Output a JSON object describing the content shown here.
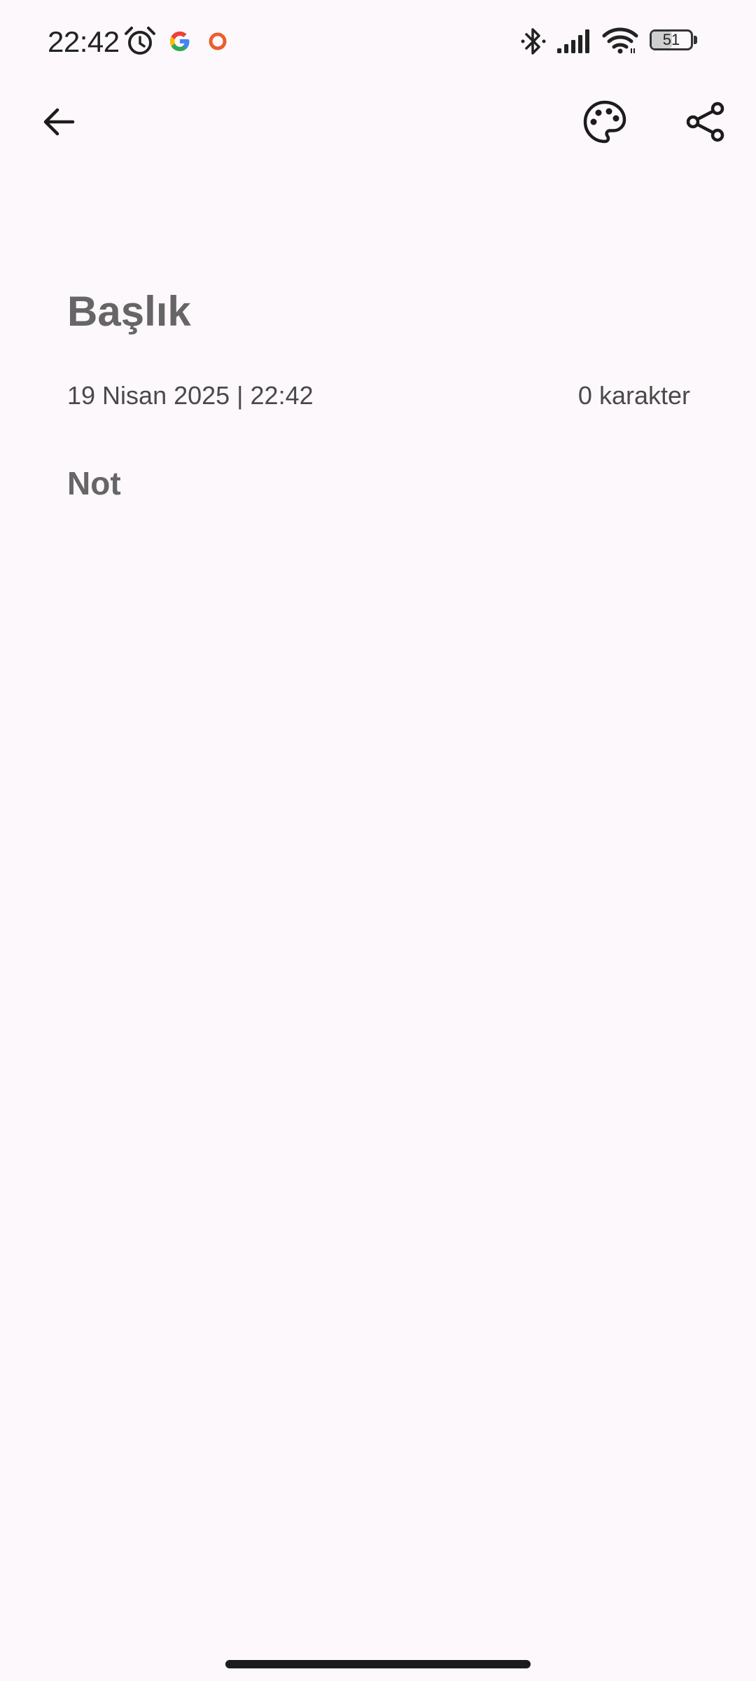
{
  "status_bar": {
    "time": "22:42",
    "battery_level": "51",
    "battery_fraction": 0.51,
    "icons": [
      "alarm-icon",
      "google-icon",
      "notification-dot-icon",
      "bluetooth-icon",
      "cellular-signal-icon",
      "wifi-icon",
      "battery-icon"
    ]
  },
  "app_bar": {
    "icons": [
      "back-arrow-icon",
      "palette-icon",
      "share-icon"
    ]
  },
  "note": {
    "title_placeholder": "Başlık",
    "date_time": "19 Nisan 2025 | 22:42",
    "char_count": "0 karakter",
    "body_placeholder": "Not"
  },
  "colors": {
    "background": "#fdf8fb",
    "placeholder_text": "#666666",
    "meta_text": "#4a4a4a",
    "google_red": "#ea4335",
    "google_blue": "#4285f4",
    "google_yellow": "#fbbc05",
    "google_green": "#34a853",
    "notification_orange": "#e8602c"
  }
}
